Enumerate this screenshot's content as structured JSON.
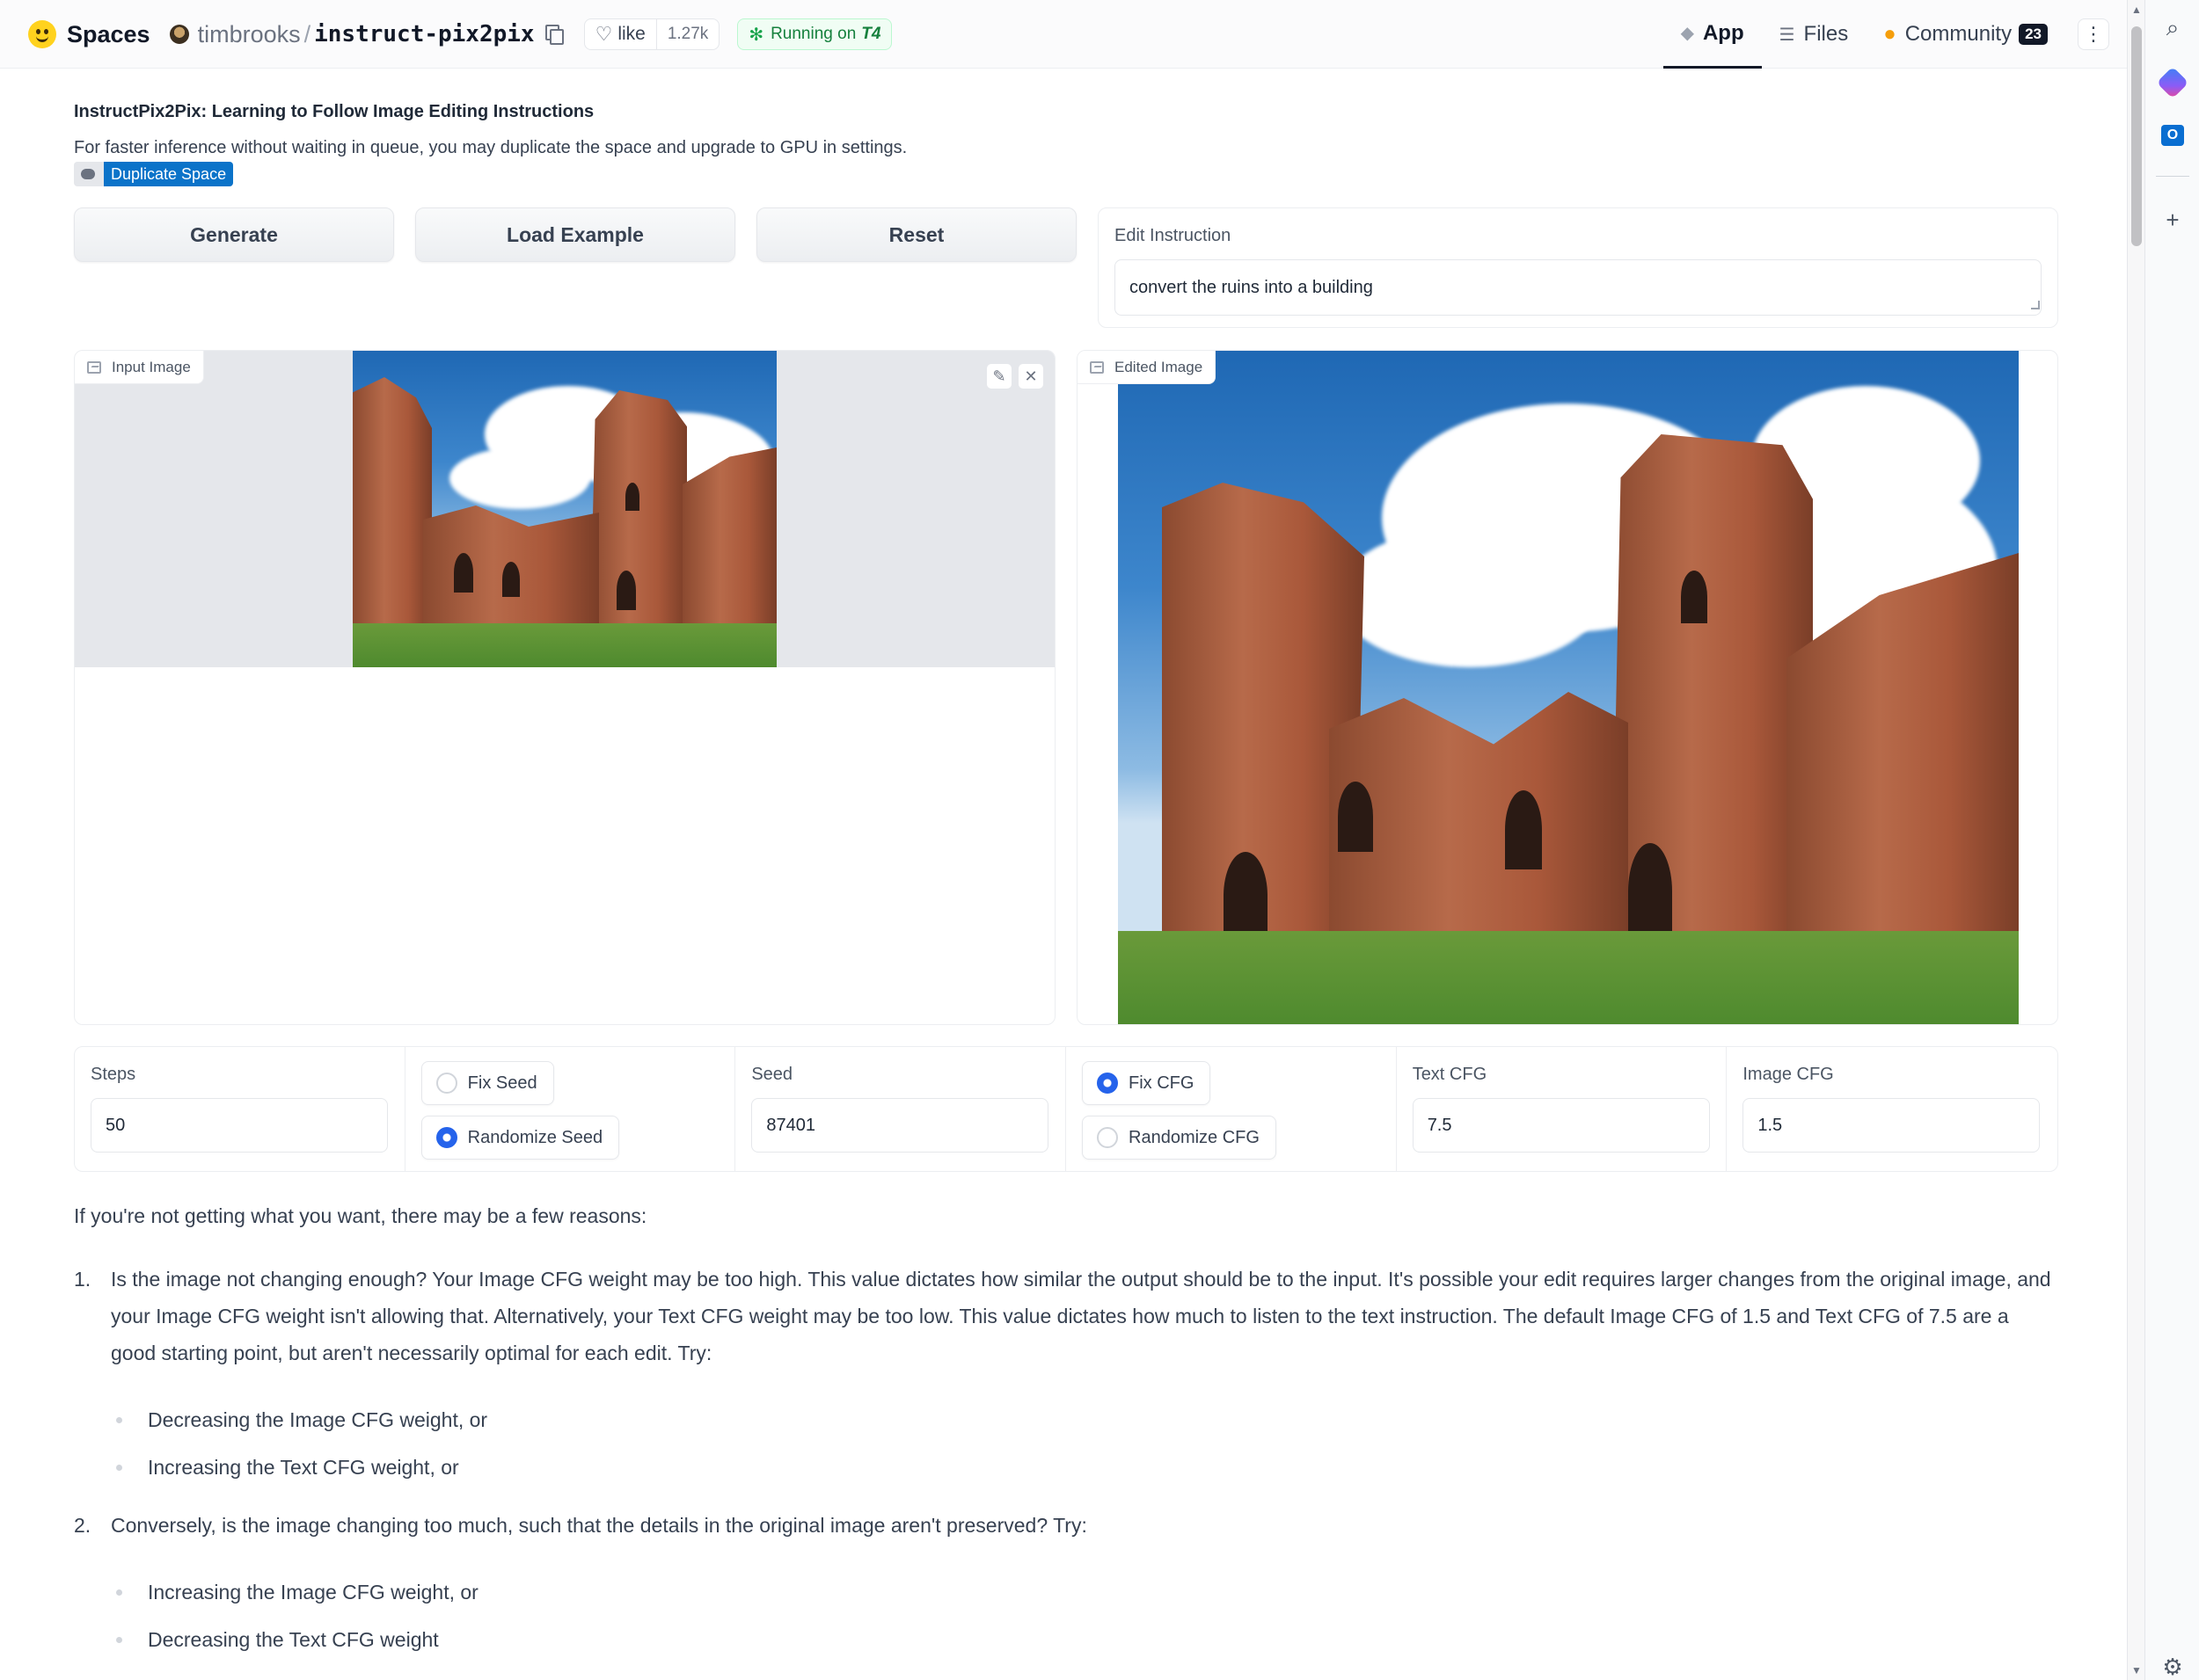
{
  "header": {
    "brand": "Spaces",
    "org": "timbrooks",
    "slash": "/",
    "repo": "instruct-pix2pix",
    "like_label": "like",
    "like_count": "1.27k",
    "running_prefix": "Running on",
    "running_hardware": "T4",
    "tabs": [
      {
        "label": "App",
        "icon": "cube-icon",
        "active": true
      },
      {
        "label": "Files",
        "icon": "files-icon",
        "active": false
      },
      {
        "label": "Community",
        "icon": "community-icon",
        "active": false,
        "badge": "23"
      }
    ]
  },
  "intro": {
    "title": "InstructPix2Pix: Learning to Follow Image Editing Instructions",
    "description": "For faster inference without waiting in queue, you may duplicate the space and upgrade to GPU in settings.",
    "duplicate_label": "Duplicate Space"
  },
  "actions": {
    "generate": "Generate",
    "load_example": "Load Example",
    "reset": "Reset"
  },
  "instruction": {
    "label": "Edit Instruction",
    "value": "convert the ruins into a building"
  },
  "images": {
    "input_label": "Input Image",
    "edited_label": "Edited Image"
  },
  "settings": {
    "steps_label": "Steps",
    "steps_value": "50",
    "fix_seed": "Fix Seed",
    "randomize_seed": "Randomize Seed",
    "seed_label": "Seed",
    "seed_value": "87401",
    "fix_cfg": "Fix CFG",
    "randomize_cfg": "Randomize CFG",
    "text_cfg_label": "Text CFG",
    "text_cfg_value": "7.5",
    "image_cfg_label": "Image CFG",
    "image_cfg_value": "1.5",
    "seed_mode_selected": "Randomize Seed",
    "cfg_mode_selected": "Fix CFG"
  },
  "guide": {
    "intro": "If you're not getting what you want, there may be a few reasons:",
    "items": [
      {
        "num": "1.",
        "text": "Is the image not changing enough? Your Image CFG weight may be too high. This value dictates how similar the output should be to the input. It's possible your edit requires larger changes from the original image, and your Image CFG weight isn't allowing that. Alternatively, your Text CFG weight may be too low. This value dictates how much to listen to the text instruction. The default Image CFG of 1.5 and Text CFG of 7.5 are a good starting point, but aren't necessarily optimal for each edit. Try:",
        "subs": [
          "Decreasing the Image CFG weight, or",
          "Increasing the Text CFG weight, or"
        ]
      },
      {
        "num": "2.",
        "text": "Conversely, is the image changing too much, such that the details in the original image aren't preserved? Try:",
        "subs": [
          "Increasing the Image CFG weight, or",
          "Decreasing the Text CFG weight"
        ]
      }
    ]
  },
  "colors": {
    "accent": "#2563eb",
    "duplicate_badge": "#0b73c9",
    "running_green": "#15803d"
  }
}
